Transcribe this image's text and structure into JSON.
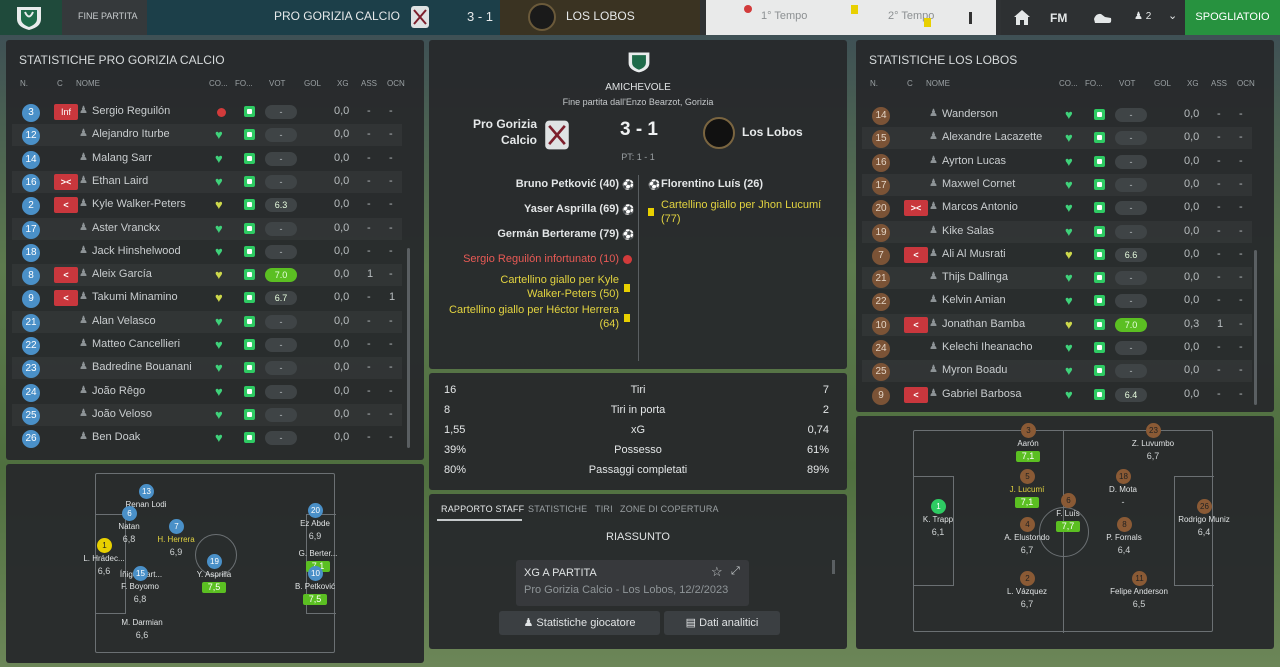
{
  "topbar": {
    "status": "FINE PARTITA",
    "home_team": "PRO GORIZIA CALCIO",
    "score": "3 - 1",
    "away_team": "LOS LOBOS",
    "first_half": "1° Tempo",
    "second_half": "2° Tempo",
    "fm": "FM",
    "people_count": "2",
    "spogliatoio": "SPOGLIATOIO"
  },
  "headers": {
    "n": "N.",
    "c": "C",
    "nome": "NOME",
    "co": "CO...",
    "fo": "FO...",
    "vot": "VOT",
    "gol": "GOL",
    "xg": "XG",
    "ass": "ASS",
    "ocn": "OCN"
  },
  "left": {
    "title": "STATISTICHE PRO GORIZIA CALCIO",
    "rows": [
      {
        "n": "3",
        "chip": "Inf",
        "name": "Sergio Reguilón",
        "cond": "red",
        "vot": "-",
        "gol": "",
        "xg": "0,0",
        "ass": "-",
        "ocn": "-"
      },
      {
        "n": "12",
        "chip": "",
        "name": "Alejandro Iturbe",
        "cond": "g",
        "vot": "-",
        "gol": "",
        "xg": "0,0",
        "ass": "-",
        "ocn": "-"
      },
      {
        "n": "14",
        "chip": "",
        "name": "Malang Sarr",
        "cond": "g",
        "vot": "-",
        "gol": "",
        "xg": "0,0",
        "ass": "-",
        "ocn": "-"
      },
      {
        "n": "16",
        "chip": "><",
        "name": "Ethan Laird",
        "cond": "g",
        "vot": "-",
        "gol": "",
        "xg": "0,0",
        "ass": "-",
        "ocn": "-"
      },
      {
        "n": "2",
        "chip": "<",
        "name": "Kyle Walker-Peters",
        "cond": "y",
        "vot": "6.3",
        "gol": "",
        "xg": "0,0",
        "ass": "-",
        "ocn": "-"
      },
      {
        "n": "17",
        "chip": "",
        "name": "Aster Vranckx",
        "cond": "g",
        "vot": "-",
        "gol": "",
        "xg": "0,0",
        "ass": "-",
        "ocn": "-"
      },
      {
        "n": "18",
        "chip": "",
        "name": "Jack Hinshelwood",
        "cond": "g",
        "vot": "-",
        "gol": "",
        "xg": "0,0",
        "ass": "-",
        "ocn": "-"
      },
      {
        "n": "8",
        "chip": "<",
        "name": "Aleix García",
        "cond": "y",
        "vot": "7.0",
        "gol": "",
        "xg": "0,0",
        "ass": "1",
        "ocn": "-"
      },
      {
        "n": "9",
        "chip": "<",
        "name": "Takumi Minamino",
        "cond": "y",
        "vot": "6.7",
        "gol": "",
        "xg": "0,0",
        "ass": "-",
        "ocn": "1"
      },
      {
        "n": "21",
        "chip": "",
        "name": "Alan Velasco",
        "cond": "g",
        "vot": "-",
        "gol": "",
        "xg": "0,0",
        "ass": "-",
        "ocn": "-"
      },
      {
        "n": "22",
        "chip": "",
        "name": "Matteo Cancellieri",
        "cond": "g",
        "vot": "-",
        "gol": "",
        "xg": "0,0",
        "ass": "-",
        "ocn": "-"
      },
      {
        "n": "23",
        "chip": "",
        "name": "Badredine Bouanani",
        "cond": "g",
        "vot": "-",
        "gol": "",
        "xg": "0,0",
        "ass": "-",
        "ocn": "-"
      },
      {
        "n": "24",
        "chip": "",
        "name": "João Rêgo",
        "cond": "g",
        "vot": "-",
        "gol": "",
        "xg": "0,0",
        "ass": "-",
        "ocn": "-"
      },
      {
        "n": "25",
        "chip": "",
        "name": "João Veloso",
        "cond": "g",
        "vot": "-",
        "gol": "",
        "xg": "0,0",
        "ass": "-",
        "ocn": "-"
      },
      {
        "n": "26",
        "chip": "",
        "name": "Ben Doak",
        "cond": "g",
        "vot": "-",
        "gol": "",
        "xg": "0,0",
        "ass": "-",
        "ocn": "-"
      }
    ],
    "pitch": [
      {
        "n": "13",
        "name": "Renan Lodi",
        "rate": "",
        "g": false
      },
      {
        "n": "6",
        "name": "Natan",
        "rate": "6,8",
        "g": false
      },
      {
        "n": "7",
        "name": "H. Herrera",
        "rate": "6,9",
        "g": false
      },
      {
        "n": "1",
        "name": "L. Hrádec...",
        "rate": "6,6",
        "g": false
      },
      {
        "n": "",
        "name": "Íñigo Mart...",
        "rate": "",
        "g": false
      },
      {
        "n": "15",
        "name": "F. Boyomo",
        "rate": "6,8",
        "g": false
      },
      {
        "n": "19",
        "name": "Y. Asprilla",
        "rate": "7,5",
        "g": true
      },
      {
        "n": "20",
        "name": "Ez Abde",
        "rate": "6,9",
        "g": false
      },
      {
        "n": "",
        "name": "G. Berter...",
        "rate": "7,1",
        "g": true
      },
      {
        "n": "10",
        "name": "B. Petković",
        "rate": "7,5",
        "g": true
      },
      {
        "n": "",
        "name": "M. Darmian",
        "rate": "6,6",
        "g": false
      }
    ]
  },
  "center": {
    "competition": "AMICHEVOLE",
    "venue": "Fine partita dall'Enzo Bearzot, Gorizia",
    "home": "Pro Gorizia Calcio",
    "score": "3 - 1",
    "away": "Los Lobos",
    "ht": "PT: 1 - 1",
    "home_events": [
      "Bruno Petković (40)",
      "Yaser Asprilla (69)",
      "Germán Berterame (79)",
      "Sergio Reguilón infortunato (10)",
      "Cartellino giallo per Kyle Walker-Peters (50)",
      "Cartellino giallo per Héctor Herrera (64)"
    ],
    "away_events": [
      "Florentino Luís (26)",
      "Cartellino giallo per Jhon Lucumí (77)"
    ],
    "stats": [
      {
        "h": "16",
        "label": "Tiri",
        "a": "7"
      },
      {
        "h": "8",
        "label": "Tiri in porta",
        "a": "2"
      },
      {
        "h": "1,55",
        "label": "xG",
        "a": "0,74"
      },
      {
        "h": "39%",
        "label": "Possesso",
        "a": "61%"
      },
      {
        "h": "80%",
        "label": "Passaggi completati",
        "a": "89%"
      }
    ],
    "tabs": [
      "RAPPORTO STAFF",
      "STATISTICHE",
      "TIRI",
      "ZONE DI COPERTURA"
    ],
    "summary": "RIASSUNTO",
    "card_title": "XG A PARTITA",
    "card_sub": "Pro Gorizia Calcio - Los Lobos, 12/2/2023",
    "btn1": "Statistiche giocatore",
    "btn2": "Dati analitici"
  },
  "right": {
    "title": "STATISTICHE LOS LOBOS",
    "rows": [
      {
        "n": "14",
        "chip": "",
        "name": "Wanderson",
        "cond": "g",
        "vot": "-",
        "xg": "0,0",
        "ass": "-",
        "ocn": "-"
      },
      {
        "n": "15",
        "chip": "",
        "name": "Alexandre Lacazette",
        "cond": "g",
        "vot": "-",
        "xg": "0,0",
        "ass": "-",
        "ocn": "-"
      },
      {
        "n": "16",
        "chip": "",
        "name": "Ayrton Lucas",
        "cond": "g",
        "vot": "-",
        "xg": "0,0",
        "ass": "-",
        "ocn": "-"
      },
      {
        "n": "17",
        "chip": "",
        "name": "Maxwel Cornet",
        "cond": "g",
        "vot": "-",
        "xg": "0,0",
        "ass": "-",
        "ocn": "-"
      },
      {
        "n": "20",
        "chip": "><",
        "name": "Marcos Antonio",
        "cond": "g",
        "vot": "-",
        "xg": "0,0",
        "ass": "-",
        "ocn": "-"
      },
      {
        "n": "19",
        "chip": "",
        "name": "Kike Salas",
        "cond": "g",
        "vot": "-",
        "xg": "0,0",
        "ass": "-",
        "ocn": "-"
      },
      {
        "n": "7",
        "chip": "<",
        "name": "Ali Al Musrati",
        "cond": "y",
        "vot": "6.6",
        "xg": "0,0",
        "ass": "-",
        "ocn": "-"
      },
      {
        "n": "21",
        "chip": "",
        "name": "Thijs Dallinga",
        "cond": "g",
        "vot": "-",
        "xg": "0,0",
        "ass": "-",
        "ocn": "-"
      },
      {
        "n": "22",
        "chip": "",
        "name": "Kelvin Amian",
        "cond": "g",
        "vot": "-",
        "xg": "0,0",
        "ass": "-",
        "ocn": "-"
      },
      {
        "n": "10",
        "chip": "<",
        "name": "Jonathan Bamba",
        "cond": "y",
        "vot": "7.0",
        "xg": "0,3",
        "ass": "1",
        "ocn": "-"
      },
      {
        "n": "24",
        "chip": "",
        "name": "Kelechi Iheanacho",
        "cond": "g",
        "vot": "-",
        "xg": "0,0",
        "ass": "-",
        "ocn": "-"
      },
      {
        "n": "25",
        "chip": "",
        "name": "Myron Boadu",
        "cond": "g",
        "vot": "-",
        "xg": "0,0",
        "ass": "-",
        "ocn": "-"
      },
      {
        "n": "9",
        "chip": "<",
        "name": "Gabriel Barbosa",
        "cond": "g",
        "vot": "6.4",
        "xg": "0,0",
        "ass": "-",
        "ocn": "-"
      }
    ],
    "pitch": [
      {
        "n": "3",
        "name": "Aarón",
        "rate": "7,1",
        "g": true
      },
      {
        "n": "23",
        "name": "Z. Luvumbo",
        "rate": "6,7",
        "g": false
      },
      {
        "n": "5",
        "name": "J. Lucumí",
        "rate": "7,1",
        "g": true
      },
      {
        "n": "6",
        "name": "F. Luís",
        "rate": "7,7",
        "g": true
      },
      {
        "n": "18",
        "name": "D. Mota",
        "rate": "-",
        "g": false
      },
      {
        "n": "1",
        "name": "K. Trapp",
        "rate": "6,1",
        "g": false
      },
      {
        "n": "4",
        "name": "A. Elustondo",
        "rate": "6,7",
        "g": false
      },
      {
        "n": "8",
        "name": "P. Fornals",
        "rate": "6,4",
        "g": false
      },
      {
        "n": "26",
        "name": "Rodrigo Muniz",
        "rate": "6,4",
        "g": false
      },
      {
        "n": "2",
        "name": "L. Vázquez",
        "rate": "6,7",
        "g": false
      },
      {
        "n": "11",
        "name": "Felipe Anderson",
        "rate": "6,5",
        "g": false
      }
    ]
  }
}
